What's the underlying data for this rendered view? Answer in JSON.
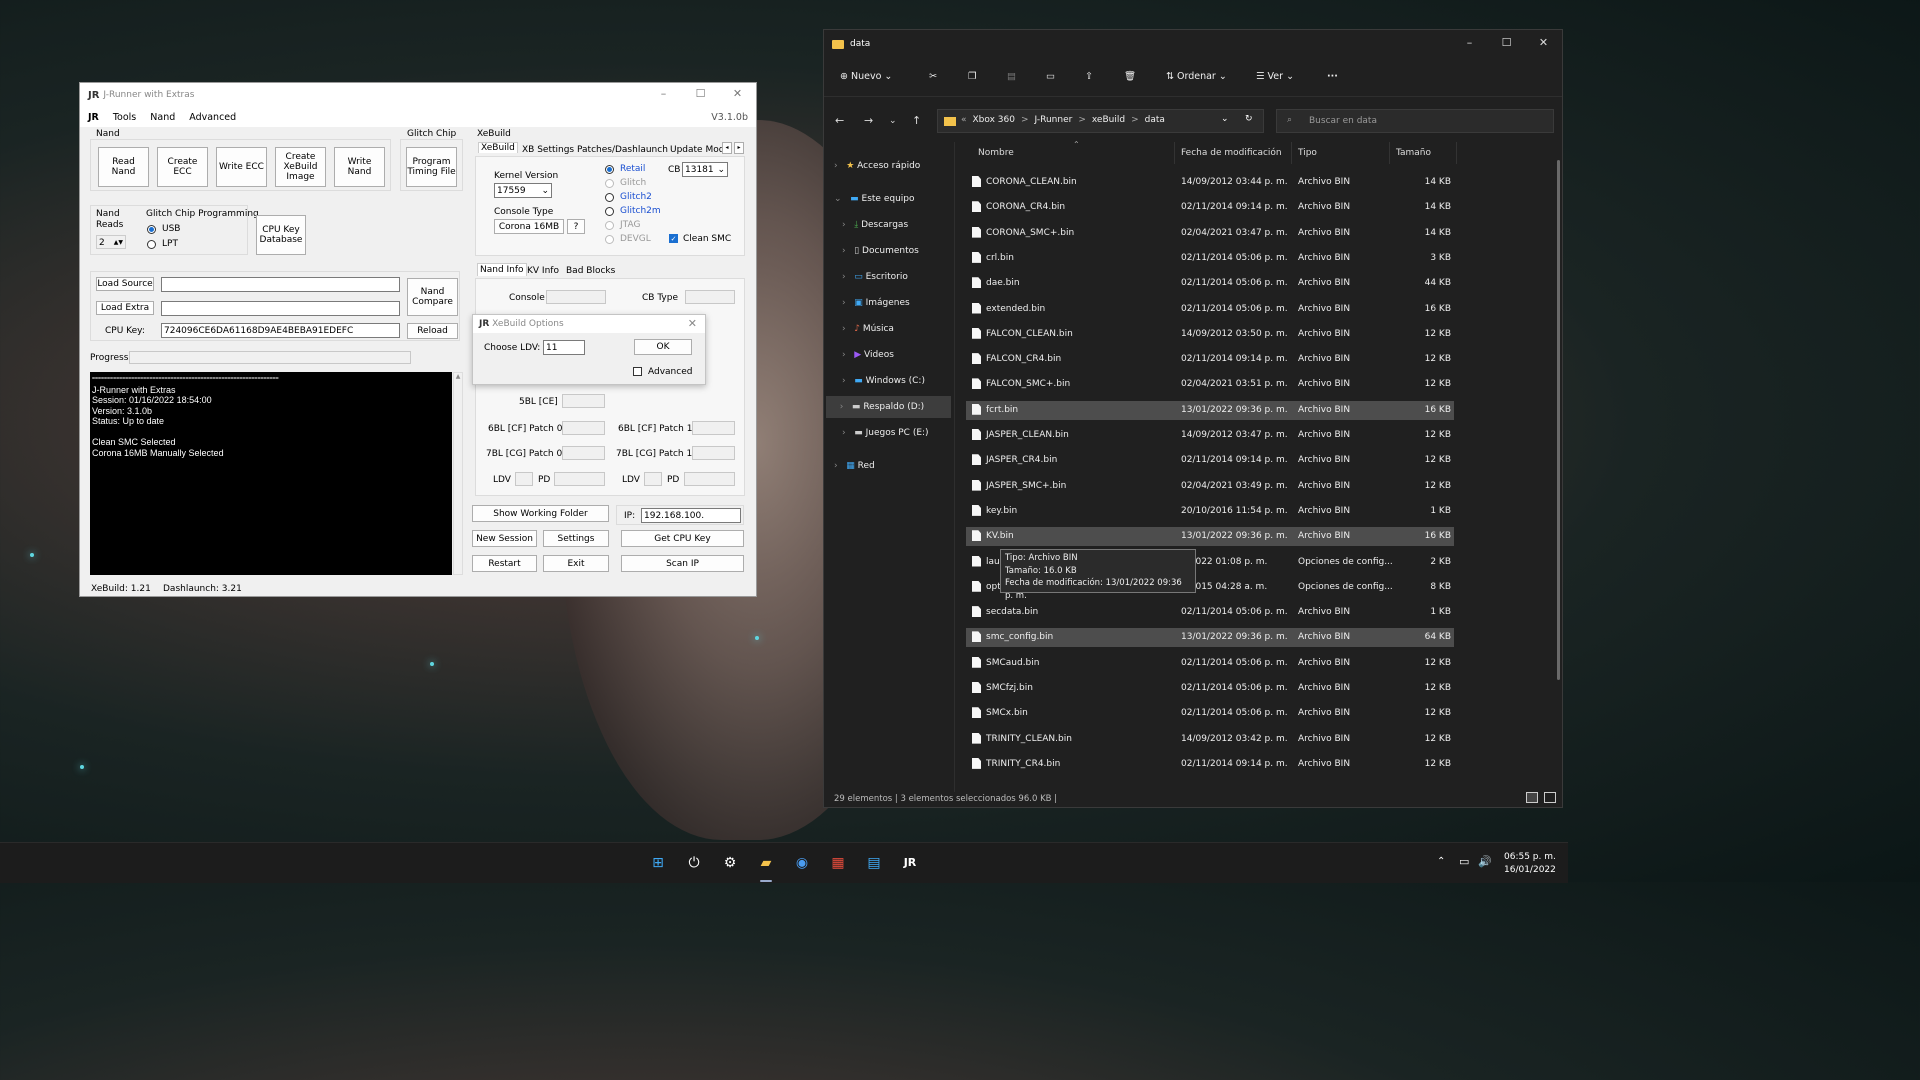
{
  "jrunner": {
    "title": "J-Runner with Extras",
    "version": "V3.1.0b",
    "menu": [
      "Tools",
      "Nand",
      "Advanced"
    ],
    "nand_group": "Nand",
    "nand_buttons": [
      "Read Nand",
      "Create ECC",
      "Write ECC",
      "Create XeBuild Image",
      "Write Nand"
    ],
    "glitch_group": "Glitch Chip",
    "program_timing": "Program Timing File",
    "nand_reads_label": "Nand Reads",
    "nand_reads_value": "2",
    "glitch_prog_label": "Glitch Chip Programming",
    "usb": "USB",
    "lpt": "LPT",
    "cpu_key_db": "CPU Key Database",
    "load_source": "Load Source",
    "load_extra": "Load Extra",
    "cpu_key_label": "CPU Key:",
    "cpu_key_value": "724096CE6DA61168D9AE4BEBA91EDEFC",
    "nand_compare": "Nand Compare",
    "reload": "Reload",
    "progress": "Progress",
    "console_lines": [
      "==============================================================",
      "J-Runner with Extras",
      "Session: 01/16/2022 18:54:00",
      "Version: 3.1.0b",
      "Status: Up to date",
      "",
      "Clean SMC Selected",
      "Corona 16MB Manually Selected"
    ],
    "xebuild_group": "XeBuild",
    "xebuild_tabs": [
      "XeBuild",
      "XB Settings",
      "Patches/Dashlaunch",
      "Update Mode"
    ],
    "kernel_version_label": "Kernel Version",
    "kernel_version": "17559",
    "console_type_label": "Console Type",
    "console_type": "Corona 16MB",
    "help": "?",
    "modes": [
      "Retail",
      "Glitch",
      "Glitch2",
      "Glitch2m",
      "JTAG",
      "DEVGL"
    ],
    "cb_label": "CB",
    "cb_value": "13181",
    "clean_smc": "Clean SMC",
    "info_tabs": [
      "Nand Info",
      "KV Info",
      "Bad Blocks"
    ],
    "console_label": "Console",
    "cb_type_label": "CB Type",
    "dialog": {
      "title": "XeBuild Options",
      "ldv_label": "Choose LDV:",
      "ldv_value": "11",
      "ok": "OK",
      "advanced": "Advanced"
    },
    "fields": [
      "5BL [CE]",
      "6BL [CF] Patch 0",
      "6BL [CF] Patch 1",
      "7BL [CG] Patch 0",
      "7BL [CG] Patch 1",
      "LDV",
      "PD",
      "LDV",
      "PD"
    ],
    "show_working_folder": "Show Working Folder",
    "ip_label": "IP:",
    "ip_value": "192.168.100.",
    "new_session": "New Session",
    "settings": "Settings",
    "get_cpu_key": "Get CPU Key",
    "restart": "Restart",
    "exit": "Exit",
    "scan_ip": "Scan IP",
    "status_xebuild": "XeBuild:  1.21",
    "status_dashlaunch": "Dashlaunch:  3.21"
  },
  "explorer": {
    "title": "data",
    "cmd": {
      "new": "Nuevo",
      "sort": "Ordenar",
      "view": "Ver",
      "more": "···"
    },
    "breadcrumb": [
      "«",
      "Xbox 360",
      ">",
      "J-Runner",
      ">",
      "xeBuild",
      ">",
      "data"
    ],
    "search_placeholder": "Buscar en data",
    "sidebar": [
      "Acceso rápido",
      "Este equipo",
      "Descargas",
      "Documentos",
      "Escritorio",
      "Imágenes",
      "Música",
      "Videos",
      "Windows (C:)",
      "Respaldo (D:)",
      "Juegos PC (E:)",
      "Red"
    ],
    "columns": [
      "Nombre",
      "Fecha de modificación",
      "Tipo",
      "Tamaño"
    ],
    "files": [
      {
        "name": "CORONA_CLEAN.bin",
        "date": "14/09/2012 03:44 p. m.",
        "type": "Archivo BIN",
        "size": "14 KB"
      },
      {
        "name": "CORONA_CR4.bin",
        "date": "02/11/2014 09:14 p. m.",
        "type": "Archivo BIN",
        "size": "14 KB"
      },
      {
        "name": "CORONA_SMC+.bin",
        "date": "02/04/2021 03:47 p. m.",
        "type": "Archivo BIN",
        "size": "14 KB"
      },
      {
        "name": "crl.bin",
        "date": "02/11/2014 05:06 p. m.",
        "type": "Archivo BIN",
        "size": "3 KB"
      },
      {
        "name": "dae.bin",
        "date": "02/11/2014 05:06 p. m.",
        "type": "Archivo BIN",
        "size": "44 KB"
      },
      {
        "name": "extended.bin",
        "date": "02/11/2014 05:06 p. m.",
        "type": "Archivo BIN",
        "size": "16 KB"
      },
      {
        "name": "FALCON_CLEAN.bin",
        "date": "14/09/2012 03:50 p. m.",
        "type": "Archivo BIN",
        "size": "12 KB"
      },
      {
        "name": "FALCON_CR4.bin",
        "date": "02/11/2014 09:14 p. m.",
        "type": "Archivo BIN",
        "size": "12 KB"
      },
      {
        "name": "FALCON_SMC+.bin",
        "date": "02/04/2021 03:51 p. m.",
        "type": "Archivo BIN",
        "size": "12 KB"
      },
      {
        "name": "fcrt.bin",
        "date": "13/01/2022 09:36 p. m.",
        "type": "Archivo BIN",
        "size": "16 KB"
      },
      {
        "name": "JASPER_CLEAN.bin",
        "date": "14/09/2012 03:47 p. m.",
        "type": "Archivo BIN",
        "size": "12 KB"
      },
      {
        "name": "JASPER_CR4.bin",
        "date": "02/11/2014 09:14 p. m.",
        "type": "Archivo BIN",
        "size": "12 KB"
      },
      {
        "name": "JASPER_SMC+.bin",
        "date": "02/04/2021 03:49 p. m.",
        "type": "Archivo BIN",
        "size": "12 KB"
      },
      {
        "name": "key.bin",
        "date": "20/10/2016 11:54 p. m.",
        "type": "Archivo BIN",
        "size": "1 KB"
      },
      {
        "name": "KV.bin",
        "date": "13/01/2022 09:36 p. m.",
        "type": "Archivo BIN",
        "size": "16 KB"
      },
      {
        "name": "laun",
        "date": "1/2022 01:08 p. m.",
        "type": "Opciones de config...",
        "size": "2 KB"
      },
      {
        "name": "opt",
        "date": "9/2015 04:28 a. m.",
        "type": "Opciones de config...",
        "size": "8 KB"
      },
      {
        "name": "secdata.bin",
        "date": "02/11/2014 05:06 p. m.",
        "type": "Archivo BIN",
        "size": "1 KB"
      },
      {
        "name": "smc_config.bin",
        "date": "13/01/2022 09:36 p. m.",
        "type": "Archivo BIN",
        "size": "64 KB"
      },
      {
        "name": "SMCaud.bin",
        "date": "02/11/2014 05:06 p. m.",
        "type": "Archivo BIN",
        "size": "12 KB"
      },
      {
        "name": "SMCfzj.bin",
        "date": "02/11/2014 05:06 p. m.",
        "type": "Archivo BIN",
        "size": "12 KB"
      },
      {
        "name": "SMCx.bin",
        "date": "02/11/2014 05:06 p. m.",
        "type": "Archivo BIN",
        "size": "12 KB"
      },
      {
        "name": "TRINITY_CLEAN.bin",
        "date": "14/09/2012 03:42 p. m.",
        "type": "Archivo BIN",
        "size": "12 KB"
      },
      {
        "name": "TRINITY_CR4.bin",
        "date": "02/11/2014 09:14 p. m.",
        "type": "Archivo BIN",
        "size": "12 KB"
      }
    ],
    "tooltip": [
      "Tipo: Archivo BIN",
      "Tamaño: 16.0 KB",
      "Fecha de modificación: 13/01/2022 09:36 p. m."
    ],
    "status": "29 elementos  |  3 elementos seleccionados  96.0 KB  |"
  },
  "taskbar": {
    "time": "06:55 p. m.",
    "date": "16/01/2022"
  }
}
